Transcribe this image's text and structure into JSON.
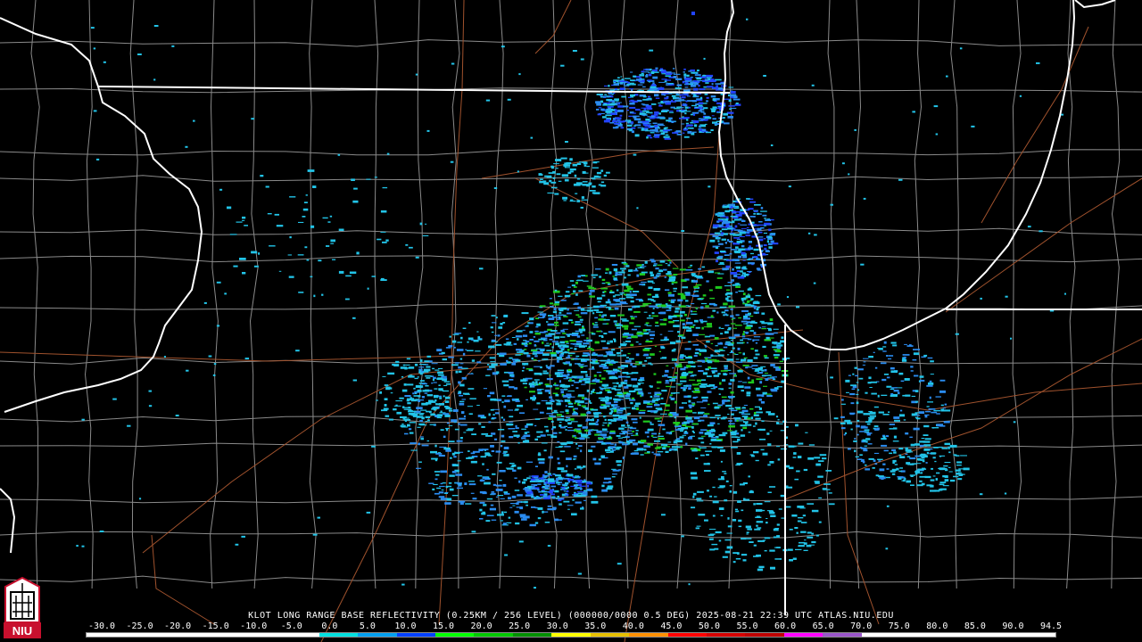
{
  "caption": "KLOT LONG RANGE BASE REFLECTIVITY (0.25KM / 256 LEVEL) (000000/0000 0.5 DEG) 2025-08-21 22:39 UTC  ATLAS.NIU.EDU",
  "logo_text": "NIU",
  "scale": {
    "labels": [
      "-30.0",
      "-25.0",
      "-20.0",
      "-15.0",
      "-10.0",
      "-5.0",
      "0.0",
      "5.0",
      "10.0",
      "15.0",
      "20.0",
      "25.0",
      "30.0",
      "35.0",
      "40.0",
      "45.0",
      "50.0",
      "55.0",
      "60.0",
      "65.0",
      "70.0",
      "75.0",
      "80.0",
      "85.0",
      "90.0",
      "94.5"
    ],
    "colors": [
      "#ffffff",
      "#ffffff",
      "#ffffff",
      "#ffffff",
      "#ffffff",
      "#ffffff",
      "#00e0e0",
      "#00a0f0",
      "#0040ff",
      "#00ff00",
      "#00c800",
      "#009000",
      "#ffff00",
      "#e7c000",
      "#ff9000",
      "#ff0000",
      "#d60000",
      "#c00000",
      "#ff00ff",
      "#9955c9",
      "#ffffff",
      "#ffffff",
      "#ffffff",
      "#ffffff",
      "#ffffff"
    ]
  },
  "colors": {
    "background": "#000000",
    "state_border": "#ffffff",
    "county_border": "#8a8a8a",
    "highway": "#a0522d",
    "echo_light": "#22c4e8",
    "echo_medium": "#2a8cf0",
    "echo_strong": "#2244ff",
    "echo_green": "#1ec81e"
  }
}
